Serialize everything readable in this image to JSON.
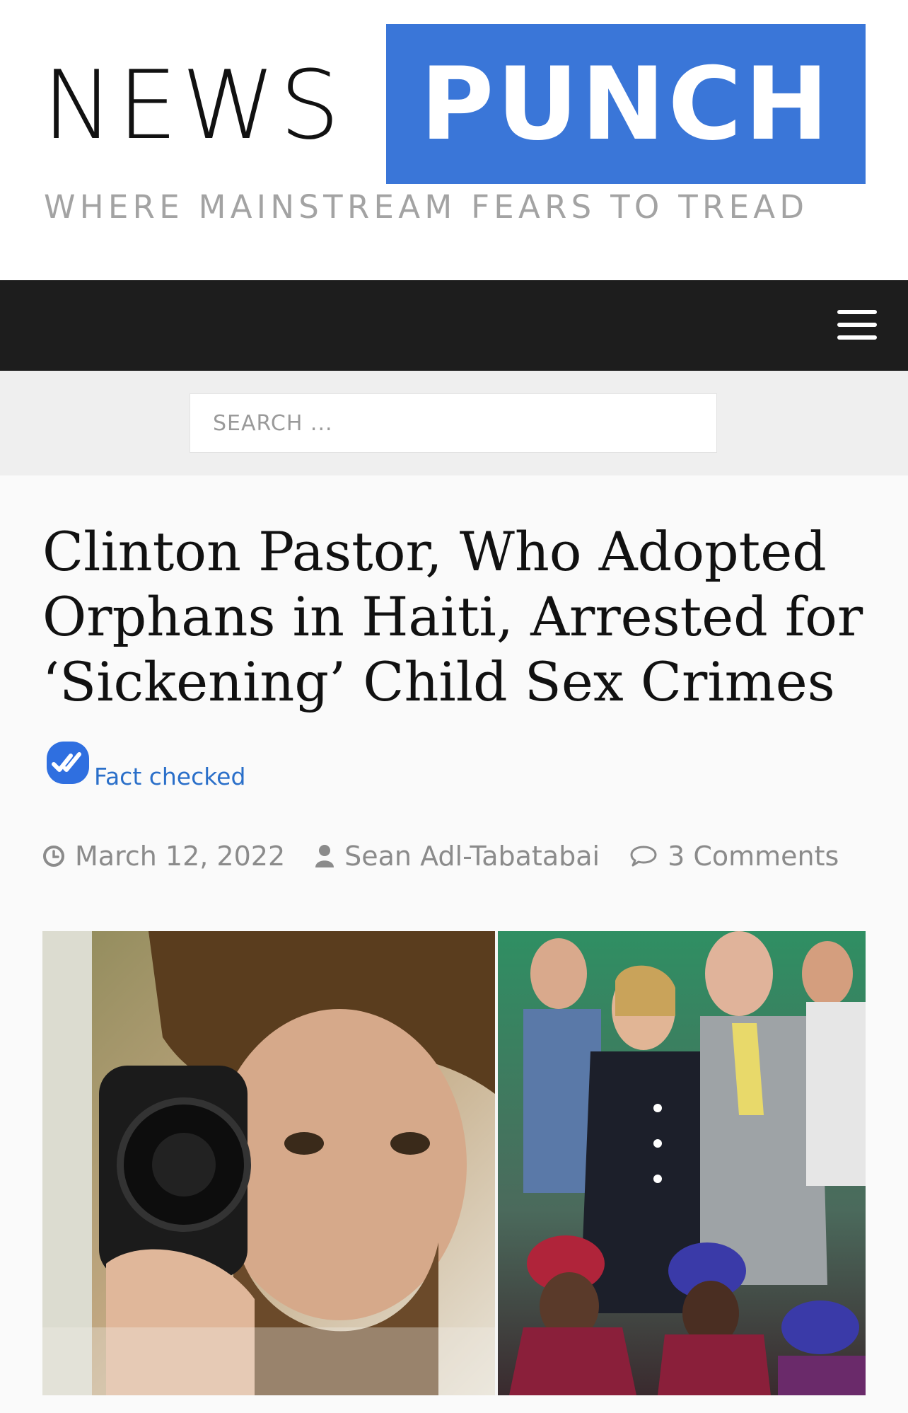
{
  "site": {
    "logo_news": "NEWS",
    "logo_punch": "PUNCH",
    "tagline": "WHERE MAINSTREAM FEARS TO TREAD"
  },
  "nav": {
    "menu_icon": "hamburger-menu-icon"
  },
  "search": {
    "placeholder": "SEARCH ..."
  },
  "article": {
    "title": "Clinton Pastor, Who Adopted Orphans in Haiti, Arrested for ‘Sickening’ Child Sex Crimes",
    "fact_check_label": "Fact checked",
    "date": "March 12, 2022",
    "author": "Sean Adl-Tabatabai",
    "comments": "3 Comments"
  },
  "icons": {
    "fact_check": "double-check-icon",
    "date": "clock-icon",
    "author": "user-icon",
    "comments": "comment-icon"
  },
  "colors": {
    "brand_blue": "#3a76d8",
    "nav_bg": "#1d1d1d",
    "link_blue": "#2a6fc9",
    "meta_gray": "#8b8b8b"
  }
}
